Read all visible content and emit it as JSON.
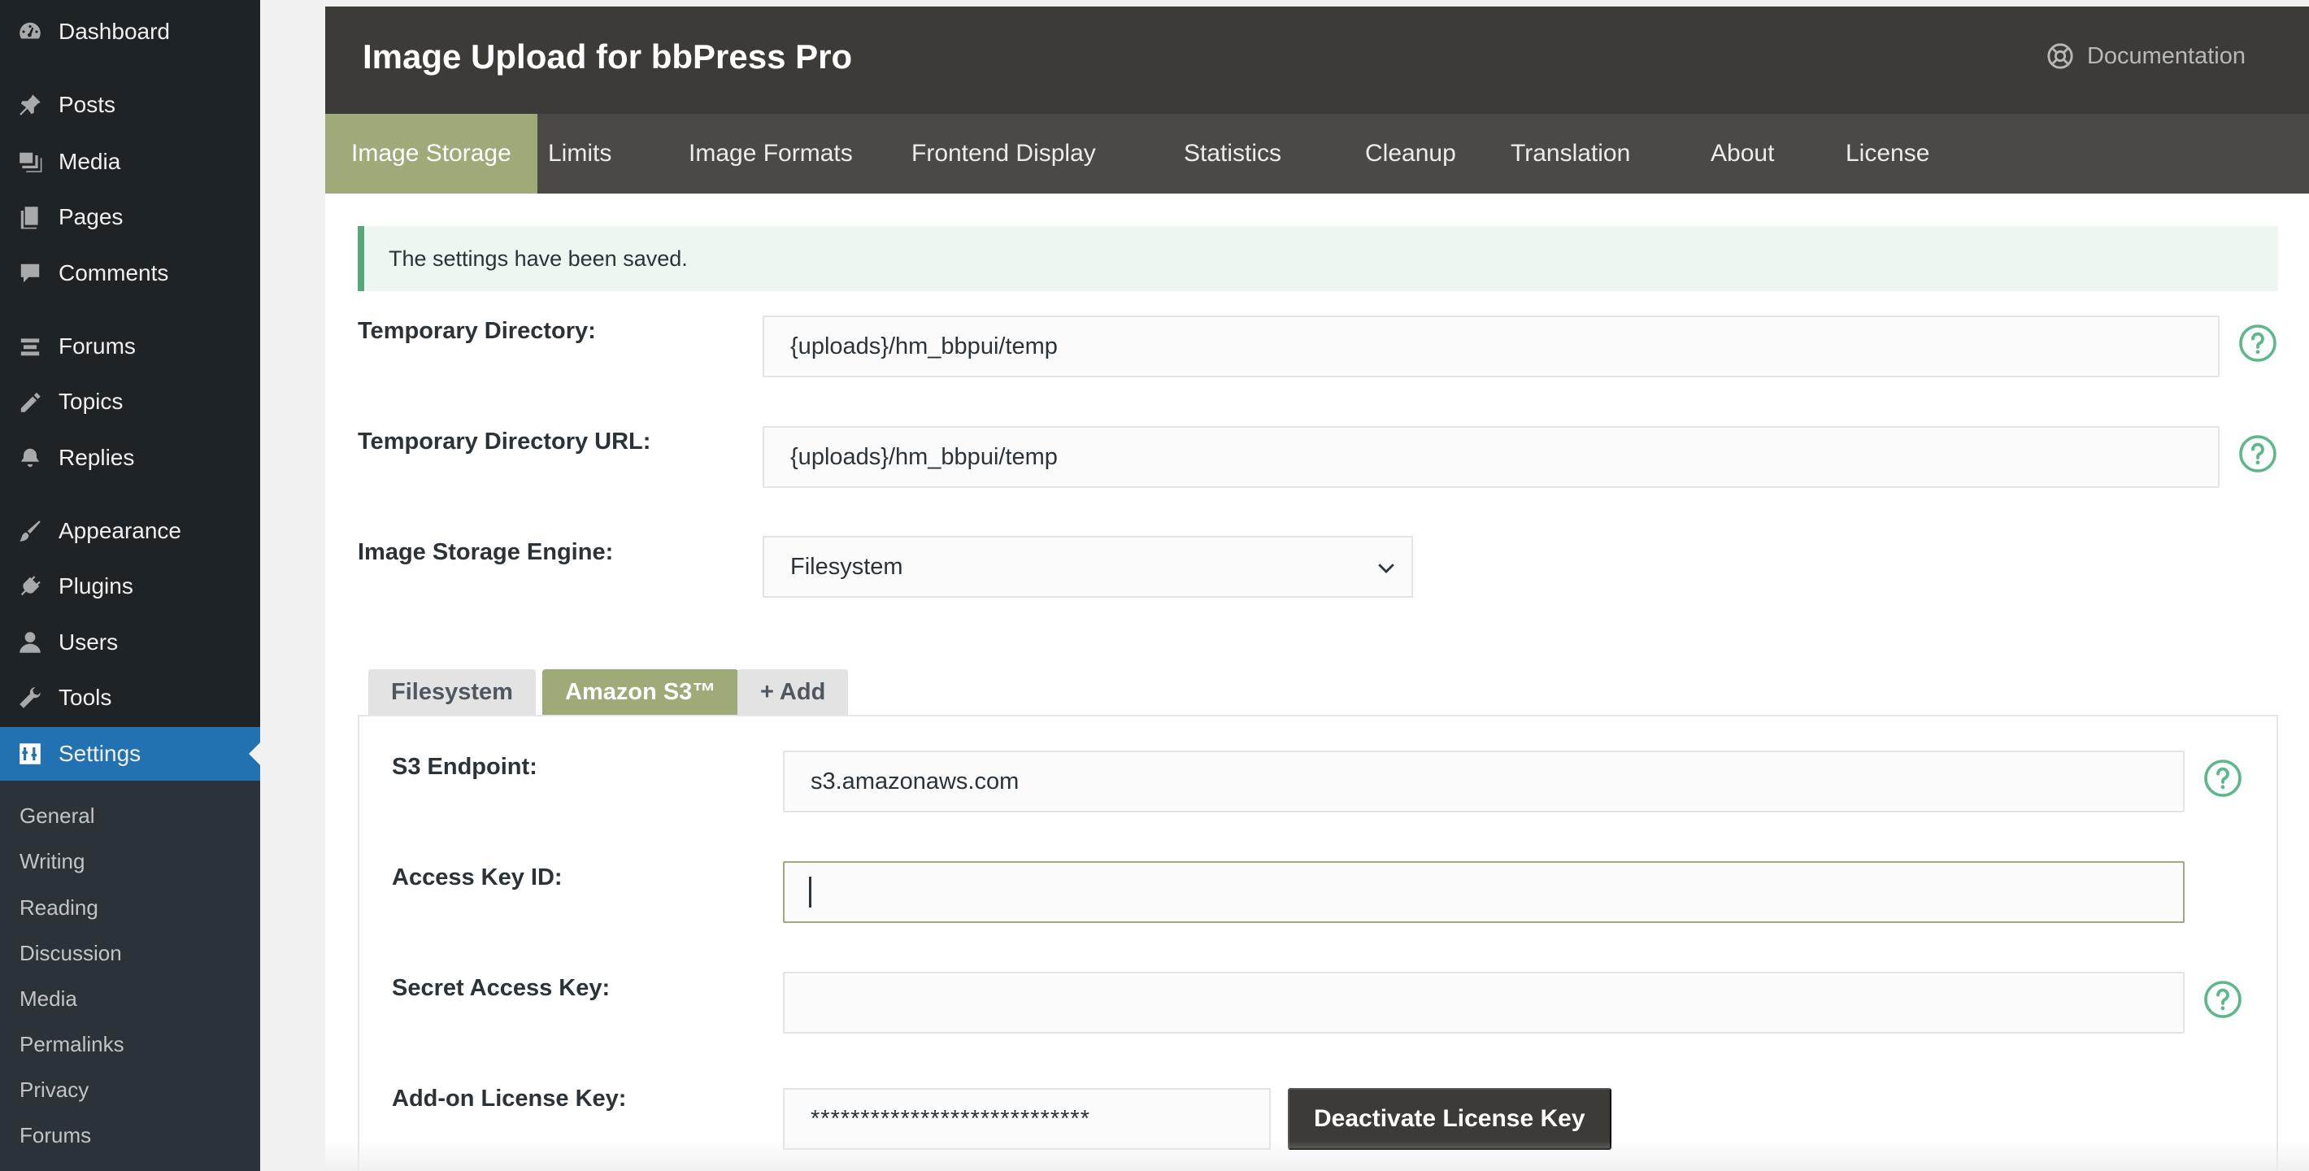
{
  "sidebar": {
    "items": [
      {
        "label": "Dashboard",
        "icon": "dashboard-icon"
      },
      {
        "label": "Posts",
        "icon": "pin-icon"
      },
      {
        "label": "Media",
        "icon": "media-icon"
      },
      {
        "label": "Pages",
        "icon": "pages-icon"
      },
      {
        "label": "Comments",
        "icon": "comment-icon"
      },
      {
        "label": "Forums",
        "icon": "forums-icon"
      },
      {
        "label": "Topics",
        "icon": "topics-icon"
      },
      {
        "label": "Replies",
        "icon": "replies-icon"
      },
      {
        "label": "Appearance",
        "icon": "paintbrush-icon"
      },
      {
        "label": "Plugins",
        "icon": "plug-icon"
      },
      {
        "label": "Users",
        "icon": "user-icon"
      },
      {
        "label": "Tools",
        "icon": "wrench-icon"
      },
      {
        "label": "Settings",
        "icon": "settings-icon"
      }
    ],
    "active": "Settings",
    "submenu": [
      "General",
      "Writing",
      "Reading",
      "Discussion",
      "Media",
      "Permalinks",
      "Privacy",
      "Forums"
    ]
  },
  "header": {
    "title": "Image Upload for bbPress Pro",
    "documentation": "Documentation"
  },
  "tabs": [
    "Image Storage",
    "Limits",
    "Image Formats",
    "Frontend Display",
    "Statistics",
    "Cleanup",
    "Translation",
    "About",
    "License"
  ],
  "active_tab": "Image Storage",
  "notice": "The settings have been saved.",
  "fields": {
    "temp_dir": {
      "label": "Temporary Directory:",
      "value": "{uploads}/hm_bbpui/temp"
    },
    "temp_dir_url": {
      "label": "Temporary Directory URL:",
      "value": "{uploads}/hm_bbpui/temp"
    },
    "storage_engine": {
      "label": "Image Storage Engine:",
      "value": "Filesystem"
    }
  },
  "storage_tabs": [
    "Filesystem",
    "Amazon S3™",
    "+ Add"
  ],
  "active_storage_tab": "Amazon S3™",
  "s3": {
    "endpoint": {
      "label": "S3 Endpoint:",
      "value": "s3.amazonaws.com"
    },
    "access_key": {
      "label": "Access Key ID:",
      "value": ""
    },
    "secret_key": {
      "label": "Secret Access Key:",
      "value": ""
    },
    "license_key": {
      "label": "Add-on License Key:",
      "value": "****************************"
    },
    "deactivate_label": "Deactivate License Key"
  },
  "colors": {
    "accent": "#9eaa78",
    "header_bg": "#3c3b37",
    "sidebar_bg": "#1d2327",
    "active_menu": "#2271b1",
    "help_icon": "#5cb88a"
  }
}
